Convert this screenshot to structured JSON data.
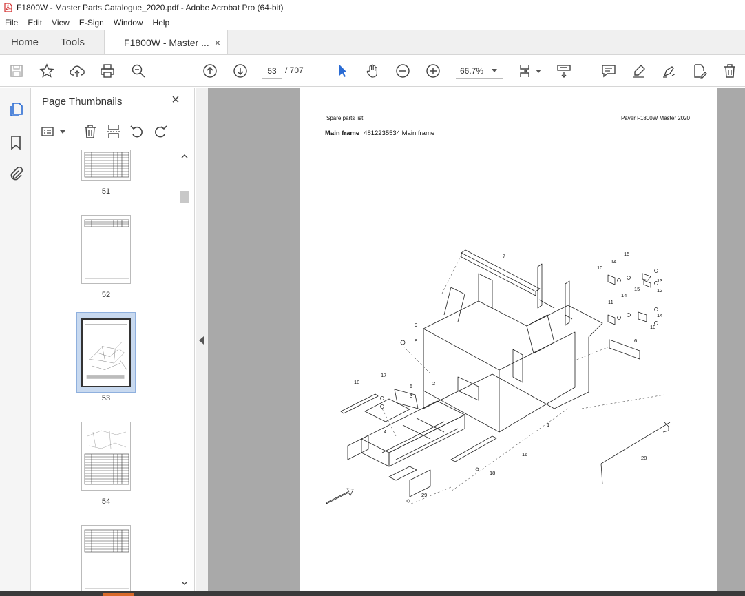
{
  "window": {
    "title": "F1800W - Master Parts Catalogue_2020.pdf - Adobe Acrobat Pro (64-bit)"
  },
  "menu": [
    "File",
    "Edit",
    "View",
    "E-Sign",
    "Window",
    "Help"
  ],
  "tabs": {
    "home": "Home",
    "tools": "Tools",
    "document": "F1800W - Master ...",
    "close": "×"
  },
  "toolbar": {
    "current_page": "53",
    "total_pages": "/ 707",
    "zoom": "66.7%"
  },
  "panel": {
    "title": "Page Thumbnails",
    "close": "×",
    "thumbnails": [
      {
        "label": "51"
      },
      {
        "label": "52"
      },
      {
        "label": "53",
        "selected": true
      },
      {
        "label": "54"
      },
      {
        "label": ""
      }
    ]
  },
  "page": {
    "header_left": "Spare parts list",
    "header_right": "Paver F1800W Master 2020",
    "title_bold": "Main frame",
    "title_rest": "4812235534 Main frame",
    "callouts": [
      "7",
      "10",
      "15",
      "14",
      "15",
      "13",
      "12",
      "14",
      "15",
      "11",
      "14",
      "15",
      "10",
      "6",
      "9",
      "8",
      "17",
      "18",
      "5",
      "3",
      "2",
      "4",
      "1",
      "16",
      "18",
      "28",
      "29"
    ]
  },
  "colors": {
    "accent": "#2b6cd4",
    "canvas_bg": "#a9a9a9",
    "selection": "#c8d9ef"
  }
}
